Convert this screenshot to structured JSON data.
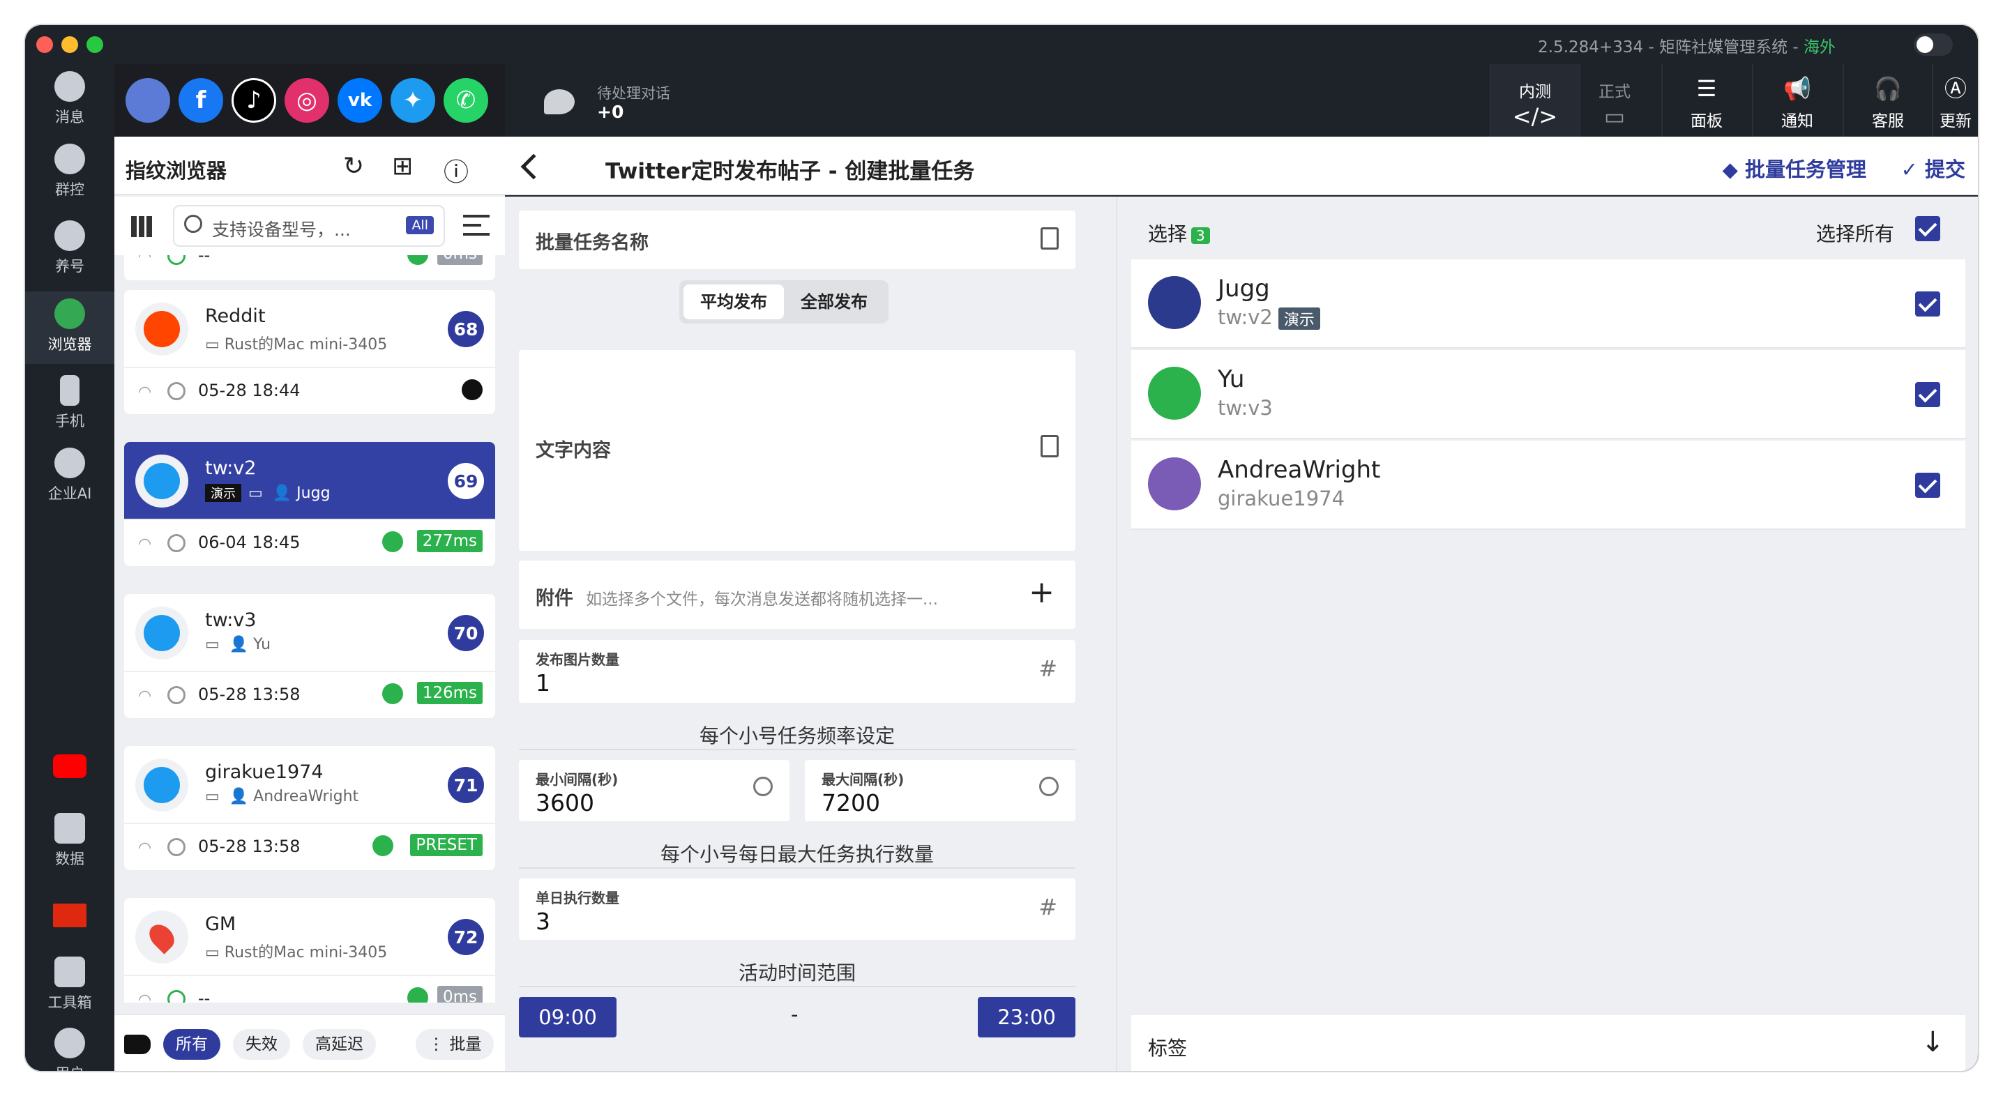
{
  "window": {
    "version": "2.5.284+334",
    "separator": "-",
    "app_name": "矩阵社媒管理系统",
    "separator2": "-",
    "region": "海外"
  },
  "rail": {
    "items": [
      {
        "label": "消息",
        "icon": "message-icon"
      },
      {
        "label": "群控",
        "icon": "group-control-icon"
      },
      {
        "label": "养号",
        "icon": "nurture-account-icon"
      },
      {
        "label": "浏览器",
        "icon": "chrome-icon",
        "active": true
      },
      {
        "label": "手机",
        "icon": "phone-icon"
      },
      {
        "label": "企业AI",
        "icon": "ai-icon"
      },
      {
        "label": "数据",
        "icon": "chart-icon"
      },
      {
        "label": "工具箱",
        "icon": "toolbox-icon"
      },
      {
        "label": "用户",
        "icon": "user-icon"
      }
    ]
  },
  "social": [
    "browser",
    "facebook",
    "tiktok",
    "instagram",
    "vk",
    "twitter",
    "whatsapp"
  ],
  "topbar": {
    "pending_label": "待处理对话",
    "pending_count": "+0",
    "test_label": "内测",
    "formal_label": "正式",
    "panel_label": "面板",
    "notify_label": "通知",
    "service_label": "客服",
    "update_label": "更新"
  },
  "list": {
    "title": "指纹浏览器",
    "search_placeholder": "支持设备型号，...",
    "search_all": "All",
    "partial_time": "--",
    "partial_latency": "0ms",
    "cards": [
      {
        "name": "Reddit",
        "sub": "Rust的Mac mini-3405",
        "num": "68",
        "time": "05-28 18:44",
        "latency": ""
      },
      {
        "name": "tw:v2",
        "demo": "演示",
        "sub": "Jugg",
        "num": "69",
        "time": "06-04 18:45",
        "latency": "277ms"
      },
      {
        "name": "tw:v3",
        "sub": "Yu",
        "num": "70",
        "time": "05-28 13:58",
        "latency": "126ms"
      },
      {
        "name": "girakue1974",
        "sub": "AndreaWright",
        "num": "71",
        "time": "05-28 13:58",
        "latency": "PRESET"
      },
      {
        "name": "GM",
        "sub": "Rust的Mac mini-3405",
        "num": "72",
        "time": "--",
        "latency": "0ms"
      }
    ],
    "filters": {
      "all": "所有",
      "invalid": "失效",
      "high_latency": "高延迟",
      "batch": "批量"
    }
  },
  "center": {
    "title": "Twitter定时发布帖子 - 创建批量任务",
    "manage": "批量任务管理",
    "submit": "提交"
  },
  "form": {
    "task_name_label": "批量任务名称",
    "seg_even": "平均发布",
    "seg_all": "全部发布",
    "text_label": "文字内容",
    "attach_label": "附件",
    "attach_hint": "如选择多个文件，每次消息发送都将随机选择一...",
    "images_label": "发布图片数量",
    "images_value": "1",
    "freq_title": "每个小号任务频率设定",
    "min_label": "最小间隔(秒)",
    "min_value": "3600",
    "max_label": "最大间隔(秒)",
    "max_value": "7200",
    "daily_title": "每个小号每日最大任务执行数量",
    "daily_label": "单日执行数量",
    "daily_value": "3",
    "range_title": "活动时间范围",
    "start": "09:00",
    "dash": "-",
    "end": "23:00"
  },
  "selection": {
    "label": "选择",
    "count": "3",
    "select_all": "选择所有",
    "accounts": [
      {
        "name": "Jugg",
        "sub": "tw:v2",
        "demo": "演示"
      },
      {
        "name": "Yu",
        "sub": "tw:v3"
      },
      {
        "name": "AndreaWright",
        "sub": "girakue1974"
      }
    ],
    "tags_label": "标签"
  }
}
